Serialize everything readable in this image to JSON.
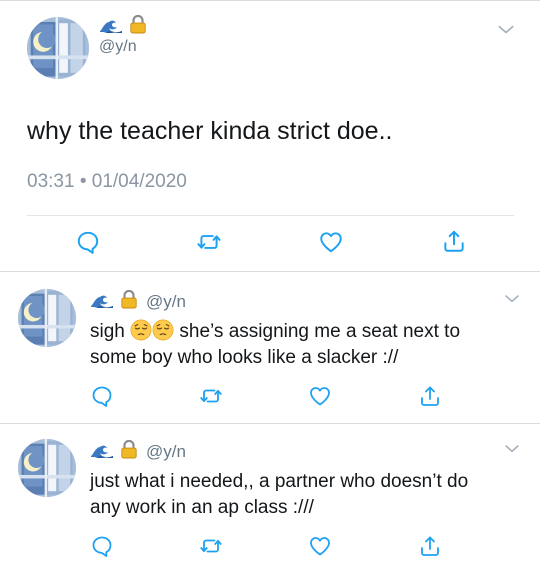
{
  "main_tweet": {
    "handle": "@y/n",
    "badge_icons": [
      "wave-icon",
      "lock-icon"
    ],
    "text": "why the teacher kinda strict doe..",
    "time": "03:31",
    "separator": "•",
    "date": "01/04/2020"
  },
  "replies": [
    {
      "handle": "@y/n",
      "badge_icons": [
        "wave-icon",
        "lock-icon"
      ],
      "word": "sigh",
      "emoji_icons": [
        "pensive-face-icon",
        "pensive-face-icon"
      ],
      "line1": "she’s assigning me a seat next to",
      "line2": "some boy who looks like a slacker ://"
    },
    {
      "handle": "@y/n",
      "badge_icons": [
        "wave-icon",
        "lock-icon"
      ],
      "line1": "just what i needed,, a partner who doesn’t do",
      "line2": "any work in an ap class :///"
    }
  ],
  "actions": [
    "reply-icon",
    "retweet-icon",
    "like-icon",
    "share-icon"
  ],
  "colors": {
    "icon": "#1da1f2",
    "text": "#14171a",
    "meta": "#8a96a3",
    "border": "#e1e6ea"
  }
}
